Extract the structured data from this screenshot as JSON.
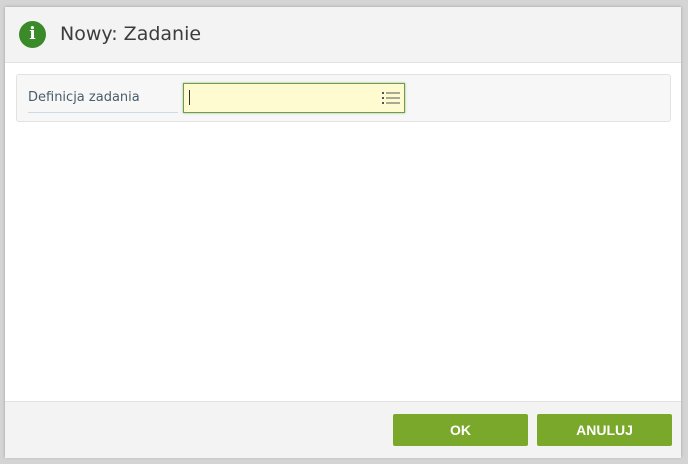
{
  "dialog": {
    "title": "Nowy: Zadanie",
    "icon": "info-icon"
  },
  "form": {
    "field_label": "Definicja zadania",
    "field_value": "",
    "field_icon": "list-icon"
  },
  "footer": {
    "ok_label": "OK",
    "cancel_label": "ANULUJ"
  },
  "colors": {
    "accent": "#7aa82a",
    "info_icon": "#3a8a2a",
    "input_bg": "#fffbd1",
    "input_border": "#6f9b4a"
  }
}
